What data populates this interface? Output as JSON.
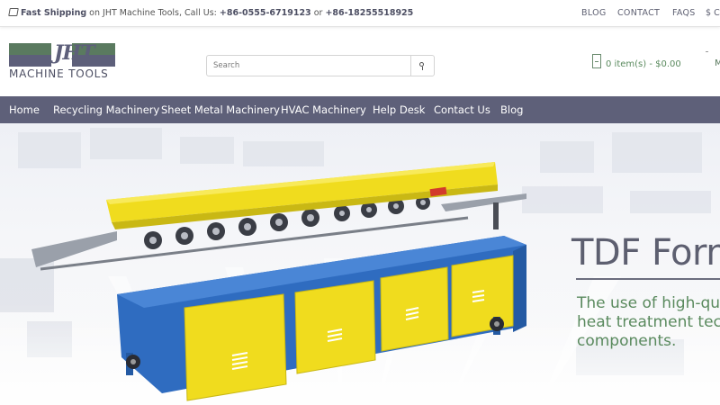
{
  "topbar": {
    "shipping_bold": "Fast Shipping",
    "shipping_text": " on JHT Machine Tools, Call Us: ",
    "phone1": "+86-0555-6719123",
    "or_text": " or ",
    "phone2": "+86-18255518925",
    "links": [
      {
        "label": "BLOG"
      },
      {
        "label": "CONTACT"
      },
      {
        "label": "FAQS"
      }
    ],
    "currency": "$ CU"
  },
  "logo": {
    "mark": "JHT",
    "tagline": "MACHINE TOOLS"
  },
  "search": {
    "placeholder": "Search"
  },
  "cart": {
    "label": "0 item(s) - $0.00"
  },
  "account": {
    "label": "M"
  },
  "nav": {
    "items": [
      {
        "label": "Home"
      },
      {
        "label": "Recycling Machinery"
      },
      {
        "label": "Sheet Metal Machinery"
      },
      {
        "label": "HVAC Machinery"
      },
      {
        "label": "Help Desk"
      },
      {
        "label": "Contact Us"
      },
      {
        "label": "Blog"
      }
    ]
  },
  "hero": {
    "title": "TDF Form",
    "body_line1": "The use of high-qua",
    "body_line2": "heat treatment tech",
    "body_line3": "components."
  },
  "colors": {
    "nav_bg": "#5e6079",
    "accent_green": "#5a8a5e",
    "machine_blue": "#2f6cc0",
    "machine_yellow": "#f0dc1e"
  }
}
